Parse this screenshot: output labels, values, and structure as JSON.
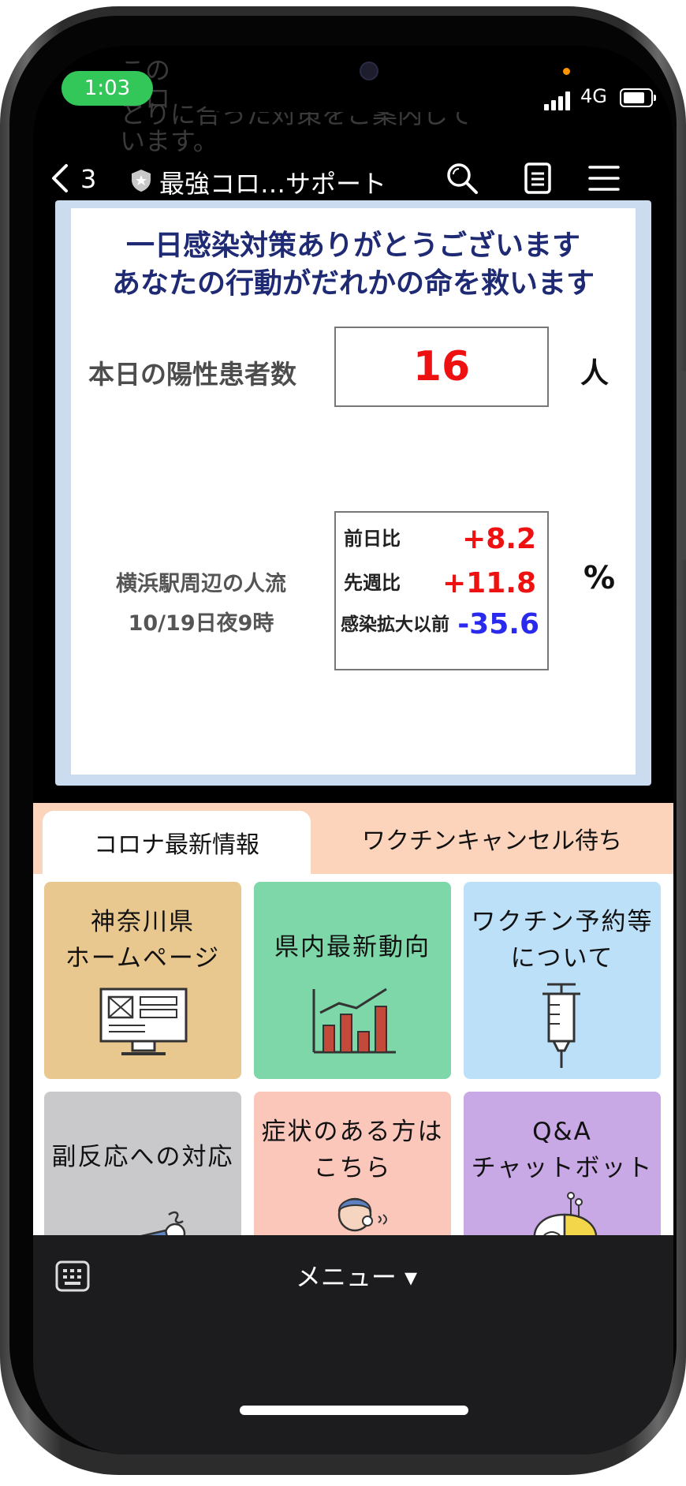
{
  "status_bar": {
    "time": "1:03",
    "network": "4G"
  },
  "header": {
    "back_label": "<",
    "back_count": "3",
    "title": "最強コロ…サポート",
    "icons": [
      "shield-icon",
      "search-icon",
      "notes-icon",
      "hamburger-menu-icon"
    ]
  },
  "info_panel": {
    "headline_1": "一日感染対策ありがとうございます",
    "headline_2": "あなたの行動がだれかの命を救います",
    "positive_label": "本日の陽性患者数",
    "positive_value": "16",
    "positive_unit": "人",
    "flow_label_1": "横浜駅周辺の人流",
    "flow_label_2": "10/19日夜9時",
    "flow_rows": [
      {
        "name": "前日比",
        "value": "+8.2",
        "color": "#ee1111"
      },
      {
        "name": "先週比",
        "value": "+11.8",
        "color": "#ee1111"
      },
      {
        "name": "感染拡大以前",
        "value": "-35.6",
        "color": "#2a2aee"
      }
    ],
    "flow_unit": "%"
  },
  "menu_tabs": [
    {
      "label": "コロナ最新情報",
      "active": true
    },
    {
      "label": "ワクチンキャンセル待ち",
      "active": false
    }
  ],
  "menu_tiles": [
    {
      "line1": "神奈川県",
      "line2": "ホームページ",
      "icon": "computer-monitor-icon",
      "color": "#e9c88f"
    },
    {
      "line1": "県内最新動向",
      "line2": "",
      "icon": "bar-chart-icon",
      "color": "#7dd7a8"
    },
    {
      "line1": "ワクチン予約等",
      "line2": "について",
      "icon": "syringe-icon",
      "color": "#bde0f9"
    },
    {
      "line1": "副反応への対応",
      "line2": "",
      "icon": "lying-person-icon",
      "color": "#c9c9cc"
    },
    {
      "line1": "症状のある方は",
      "line2": "こちら",
      "icon": "coughing-person-icon",
      "color": "#fcc7bb"
    },
    {
      "line1": "Q&A",
      "line2": "チャットボット",
      "icon": "ai-brain-icon",
      "color": "#c9a8e6"
    }
  ],
  "bottom_bar": {
    "menu_label": "メニュー ▾"
  },
  "ghost_text": [
    "この",
    "コロ",
    "とりに合った対策をご案内して",
    "います。"
  ]
}
